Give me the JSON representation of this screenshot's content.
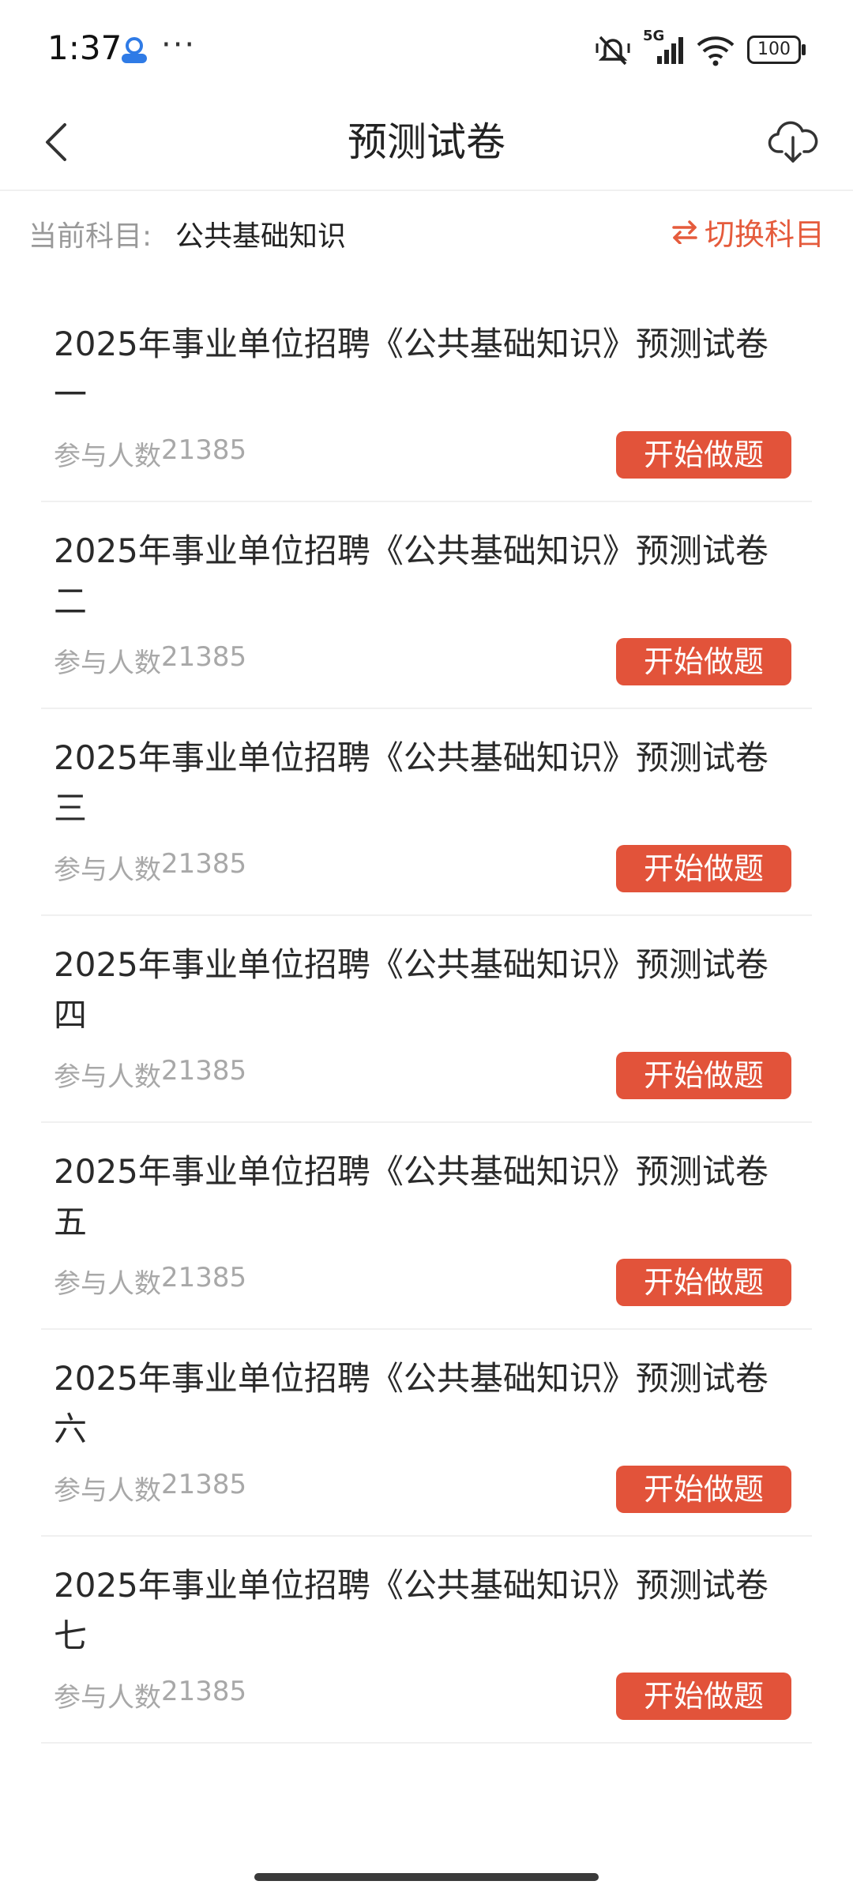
{
  "status_bar": {
    "time": "1:37",
    "more": "···",
    "network": "5G",
    "battery": "100",
    "icons": [
      "app-notification-icon",
      "mute-icon",
      "cellular-signal-icon",
      "wifi-icon",
      "battery-icon"
    ]
  },
  "header": {
    "title": "预测试卷",
    "back_icon": "chevron-left-icon",
    "download_icon": "cloud-download-icon"
  },
  "subject": {
    "label": "当前科目:",
    "value": "公共基础知识",
    "switch_label": "切换科目",
    "switch_icon": "swap-arrows-icon"
  },
  "colors": {
    "accent": "#e2533a",
    "switch_text": "#e55b3c",
    "muted_text": "#a8a8a8",
    "divider": "#f0f0f0"
  },
  "papers": [
    {
      "title": "2025年事业单位招聘《公共基础知识》预测试卷一",
      "count_label": "参与人数",
      "count": "21385",
      "button_label": "开始做题"
    },
    {
      "title": "2025年事业单位招聘《公共基础知识》预测试卷二",
      "count_label": "参与人数",
      "count": "21385",
      "button_label": "开始做题"
    },
    {
      "title": "2025年事业单位招聘《公共基础知识》预测试卷三",
      "count_label": "参与人数",
      "count": "21385",
      "button_label": "开始做题"
    },
    {
      "title": "2025年事业单位招聘《公共基础知识》预测试卷四",
      "count_label": "参与人数",
      "count": "21385",
      "button_label": "开始做题"
    },
    {
      "title": "2025年事业单位招聘《公共基础知识》预测试卷五",
      "count_label": "参与人数",
      "count": "21385",
      "button_label": "开始做题"
    },
    {
      "title": "2025年事业单位招聘《公共基础知识》预测试卷六",
      "count_label": "参与人数",
      "count": "21385",
      "button_label": "开始做题"
    },
    {
      "title": "2025年事业单位招聘《公共基础知识》预测试卷七",
      "count_label": "参与人数",
      "count": "21385",
      "button_label": "开始做题"
    }
  ]
}
